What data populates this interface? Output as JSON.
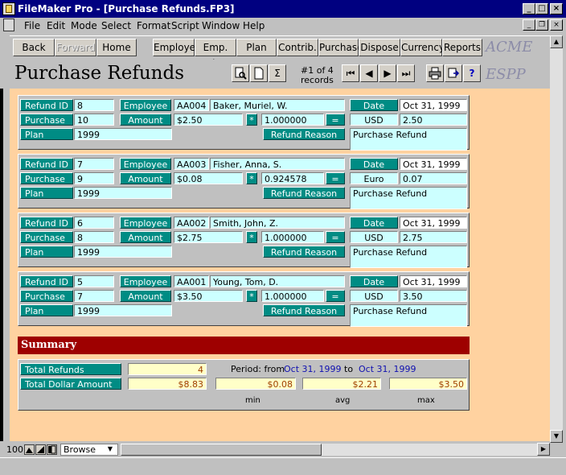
{
  "window": {
    "title": "FileMaker Pro - [Purchase Refunds.FP3]"
  },
  "menus": [
    "File",
    "Edit",
    "Mode",
    "Select",
    "Format",
    "Script",
    "Window",
    "Help"
  ],
  "nav": {
    "back": "Back",
    "forward": "Forward",
    "home": "Home",
    "employee": "Employee",
    "emp_list": "Emp. List",
    "plan": "Plan",
    "contrib": "Contrib.",
    "purchase": "Purchase",
    "dispose": "Dispose",
    "currency": "Currency",
    "reports": "Reports",
    "brand": "ACME"
  },
  "header": {
    "title": "Purchase Refunds",
    "record_count": "#1 of 4",
    "records_label": "records",
    "product": "ESPP",
    "sigma": "Σ",
    "help": "?"
  },
  "labels": {
    "refund_id": "Refund ID",
    "purchase_id": "Purchase ID",
    "plan": "Plan",
    "employee": "Employee",
    "amount": "Amount",
    "times": "*",
    "equals": "=",
    "refund_reason": "Refund Reason",
    "date": "Date"
  },
  "records": [
    {
      "refund_id": "8",
      "purchase_id": "10",
      "plan": "1999",
      "emp_code": "AA004",
      "emp_name": "Baker, Muriel, W.",
      "amount": "$2.50",
      "rate": "1.000000",
      "currency": "USD",
      "converted": "2.50",
      "date": "Oct 31, 1999",
      "reason": "Purchase Refund"
    },
    {
      "refund_id": "7",
      "purchase_id": "9",
      "plan": "1999",
      "emp_code": "AA003",
      "emp_name": "Fisher, Anna, S.",
      "amount": "$0.08",
      "rate": "0.924578",
      "currency": "Euro",
      "converted": "0.07",
      "date": "Oct 31, 1999",
      "reason": "Purchase Refund"
    },
    {
      "refund_id": "6",
      "purchase_id": "8",
      "plan": "1999",
      "emp_code": "AA002",
      "emp_name": "Smith, John, Z.",
      "amount": "$2.75",
      "rate": "1.000000",
      "currency": "USD",
      "converted": "2.75",
      "date": "Oct 31, 1999",
      "reason": "Purchase Refund"
    },
    {
      "refund_id": "5",
      "purchase_id": "7",
      "plan": "1999",
      "emp_code": "AA001",
      "emp_name": "Young, Tom, D.",
      "amount": "$3.50",
      "rate": "1.000000",
      "currency": "USD",
      "converted": "3.50",
      "date": "Oct 31, 1999",
      "reason": "Purchase Refund"
    }
  ],
  "summary": {
    "title": "Summary",
    "total_refunds_label": "Total Refunds",
    "total_refunds": "4",
    "total_dollar_label": "Total Dollar Amount",
    "total_dollar": "$8.83",
    "min": "$0.08",
    "avg": "$2.21",
    "max": "$3.50",
    "min_label": "min",
    "avg_label": "avg",
    "max_label": "max",
    "period_label": "Period: from",
    "period_from": "Oct 31, 1999",
    "to_label": "to",
    "period_to": "Oct 31, 1999"
  },
  "statusbar": {
    "zoom": "100",
    "mode": "Browse"
  },
  "colors": {
    "titlebar": "#000080",
    "label_teal": "#008c84",
    "field_cyan": "#ccffff",
    "content_bg": "#ffd2a0",
    "summary_red": "#9e0000"
  }
}
